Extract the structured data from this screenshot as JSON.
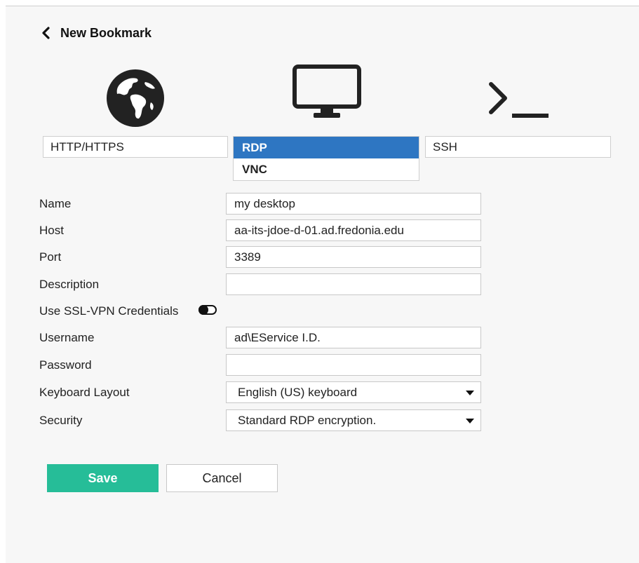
{
  "header": {
    "title": "New Bookmark"
  },
  "types": {
    "http_label": "HTTP/HTTPS",
    "ssh_label": "SSH",
    "dropdown_options": [
      "RDP",
      "VNC"
    ],
    "selected": "RDP"
  },
  "form": {
    "name_label": "Name",
    "name_value": "my desktop",
    "host_label": "Host",
    "host_value": "aa-its-jdoe-d-01.ad.fredonia.edu",
    "port_label": "Port",
    "port_value": "3389",
    "description_label": "Description",
    "description_value": "",
    "ssl_label": "Use SSL-VPN Credentials",
    "ssl_enabled": false,
    "username_label": "Username",
    "username_value": "ad\\EService I.D.",
    "password_label": "Password",
    "password_value": "",
    "keyboard_label": "Keyboard Layout",
    "keyboard_value": "English (US) keyboard",
    "security_label": "Security",
    "security_value": "Standard RDP encryption."
  },
  "buttons": {
    "save": "Save",
    "cancel": "Cancel"
  },
  "icons": {
    "back": "chevron-left-icon",
    "web": "globe-icon",
    "rdp": "monitor-icon",
    "ssh": "terminal-icon"
  },
  "colors": {
    "accent": "#26bd98",
    "selection": "#2e76c2"
  }
}
